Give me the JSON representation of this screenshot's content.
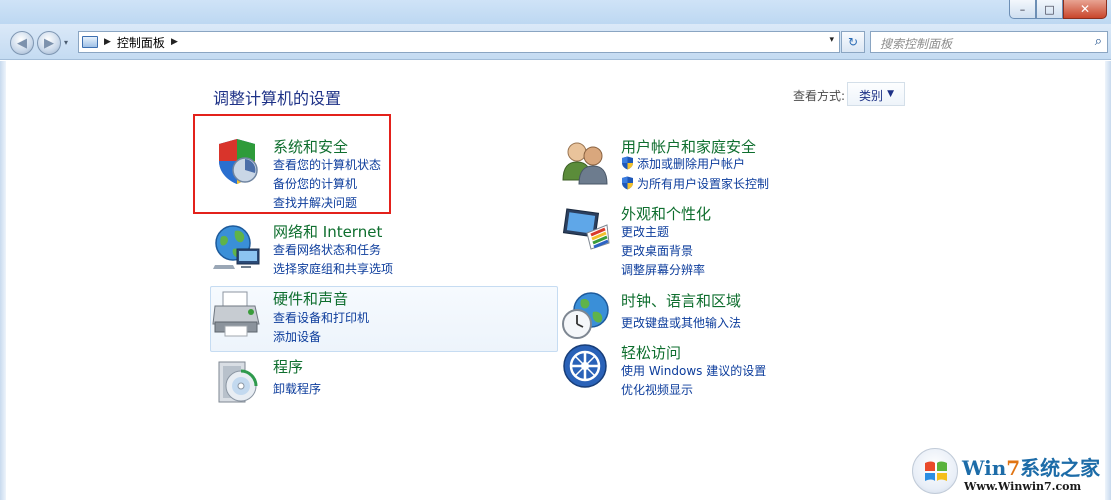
{
  "window": {
    "minimize_glyph": "–",
    "maximize_glyph": "□",
    "close_glyph": "✕"
  },
  "navbar": {
    "back_icon": "back-arrow-icon",
    "forward_icon": "forward-arrow-icon",
    "recent_pages_glyph": "▾",
    "address_icon": "control-panel-icon",
    "breadcrumb_arrow": "▶",
    "breadcrumb": "控制面板",
    "breadcrumb_next_arrow": "▶",
    "address_dropdown_glyph": "▾",
    "refresh_glyph": "↻",
    "search_placeholder": "搜索控制面板",
    "search_glyph": "⌕"
  },
  "content": {
    "title": "调整计算机的设置",
    "view_by_label": "查看方式:",
    "view_by_value": "类别",
    "view_by_caret": "▼"
  },
  "categories": [
    {
      "title": "系统和安全",
      "icon": "shield-icon",
      "links": [
        "查看您的计算机状态",
        "备份您的计算机",
        "查找并解决问题"
      ]
    },
    {
      "title": "网络和 Internet",
      "icon": "network-globe-icon",
      "links": [
        "查看网络状态和任务",
        "选择家庭组和共享选项"
      ]
    },
    {
      "title": "硬件和声音",
      "icon": "printer-icon",
      "links": [
        "查看设备和打印机",
        "添加设备"
      ]
    },
    {
      "title": "程序",
      "icon": "programs-disc-icon",
      "links": [
        "卸载程序"
      ]
    },
    {
      "title": "用户帐户和家庭安全",
      "icon": "users-icon",
      "links": [
        "添加或删除用户帐户",
        "为所有用户设置家长控制"
      ]
    },
    {
      "title": "外观和个性化",
      "icon": "monitor-palette-icon",
      "links": [
        "更改主题",
        "更改桌面背景",
        "调整屏幕分辨率"
      ]
    },
    {
      "title": "时钟、语言和区域",
      "icon": "clock-globe-icon",
      "links": [
        "更改键盘或其他输入法"
      ]
    },
    {
      "title": "轻松访问",
      "icon": "ease-of-access-icon",
      "links": [
        "使用 Windows 建议的设置",
        "优化视频显示"
      ]
    }
  ],
  "watermark": {
    "brand_prefix": "Win",
    "brand_seven": "7",
    "brand_suffix": "系统之家",
    "url": "Www.Winwin7.com"
  },
  "colors": {
    "category_title": "#0e6e2e",
    "link": "#0d3d9c",
    "heading": "#1e3287",
    "highlight_border": "#e3211b"
  }
}
